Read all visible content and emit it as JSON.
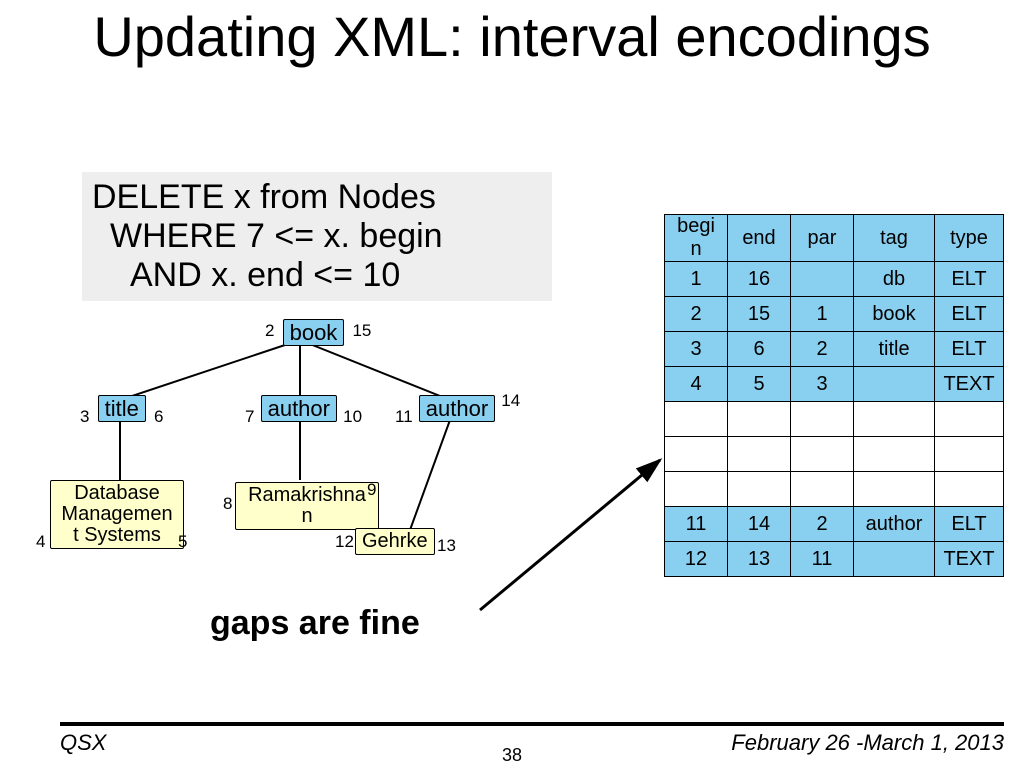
{
  "title": "Updating XML: interval encodings",
  "sql": {
    "l1": "DELETE x from Nodes",
    "l2": "WHERE 7 <= x. begin",
    "l3": "AND x. end <= 10"
  },
  "diagram": {
    "book": {
      "label": "book",
      "left": "2",
      "right": "15"
    },
    "title": {
      "label": "title",
      "left": "3",
      "right": "6"
    },
    "author1": {
      "label": "author",
      "left": "7",
      "right": "10"
    },
    "author2": {
      "label": "author",
      "left": "11",
      "right": "14"
    },
    "dbms": {
      "text1": "Database",
      "text2": "Managemen",
      "text3": "t Systems",
      "left": "4",
      "right": "5"
    },
    "rama": {
      "text": "Ramakrishna n",
      "t1": "Ramakrishna",
      "t2": "n",
      "left": "8",
      "right": "9"
    },
    "gehrke": {
      "text": "Gehrke",
      "left": "12",
      "right": "13"
    }
  },
  "gaps": "gaps are fine",
  "table": {
    "headers": {
      "begin": "begi n",
      "end": "end",
      "par": "par",
      "tag": "tag",
      "type": "type"
    },
    "rows": [
      {
        "b": "1",
        "e": "16",
        "p": "",
        "tag": "db",
        "type": "ELT"
      },
      {
        "b": "2",
        "e": "15",
        "p": "1",
        "tag": "book",
        "type": "ELT"
      },
      {
        "b": "3",
        "e": "6",
        "p": "2",
        "tag": "title",
        "type": "ELT"
      },
      {
        "b": "4",
        "e": "5",
        "p": "3",
        "tag": "",
        "type": "TEXT"
      },
      {
        "b": "",
        "e": "",
        "p": "",
        "tag": "",
        "type": "",
        "empty": true
      },
      {
        "b": "",
        "e": "",
        "p": "",
        "tag": "",
        "type": "",
        "empty": true
      },
      {
        "b": "",
        "e": "",
        "p": "",
        "tag": "",
        "type": "",
        "empty": true
      },
      {
        "b": "11",
        "e": "14",
        "p": "2",
        "tag": "author",
        "type": "ELT"
      },
      {
        "b": "12",
        "e": "13",
        "p": "11",
        "tag": "",
        "type": "TEXT"
      }
    ]
  },
  "footer": {
    "left": "QSX",
    "right": "February 26 -March 1, 2013",
    "page": "38"
  }
}
